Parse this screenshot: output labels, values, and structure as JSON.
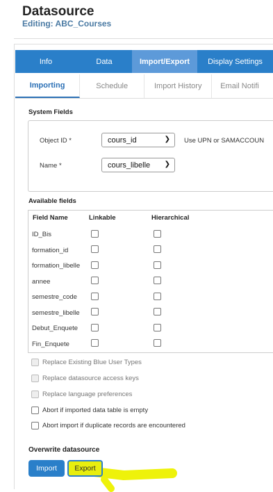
{
  "header": {
    "title": "Datasource",
    "subtitle": "Editing: ABC_Courses"
  },
  "main_tabs": [
    "Info",
    "Data",
    "Import/Export",
    "Display Settings"
  ],
  "sub_tabs": [
    "Importing",
    "Schedule",
    "Import History",
    "Email Notifi"
  ],
  "system_fields": {
    "label": "System Fields",
    "object_id_label": "Object ID *",
    "object_id_value": "cours_id",
    "object_id_hint": "Use UPN or SAMACCOUN",
    "name_label": "Name *",
    "name_value": "cours_libelle"
  },
  "available_fields": {
    "label": "Available fields",
    "headers": [
      "Field Name",
      "Linkable",
      "Hierarchical"
    ],
    "rows": [
      "ID_Bis",
      "formation_id",
      "formation_libelle",
      "annee",
      "semestre_code",
      "semestre_libelle",
      "Debut_Enquete",
      "Fin_Enquete"
    ]
  },
  "options": [
    "Replace Existing Blue User Types",
    "Replace datasource access keys",
    "Replace language preferences",
    "Abort if imported data table is empty",
    "Abort import if duplicate records are encountered"
  ],
  "overwrite": {
    "label": "Overwrite datasource",
    "import_label": "Import",
    "export_label": "Export"
  },
  "colors": {
    "primary": "#2a7fc9",
    "active_tab": "#5d9ad9",
    "highlight": "#e8ee0e"
  }
}
